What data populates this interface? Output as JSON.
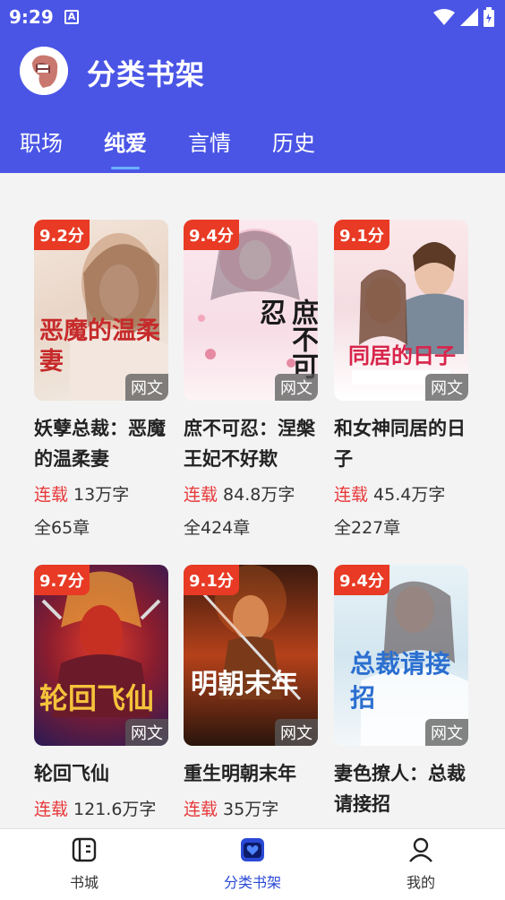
{
  "status_bar": {
    "time": "9:29",
    "notification_letter": "A"
  },
  "header": {
    "title": "分类书架"
  },
  "tabs": [
    {
      "label": "职场"
    },
    {
      "label": "纯爱"
    },
    {
      "label": "言情"
    },
    {
      "label": "历史"
    }
  ],
  "active_tab": "纯爱",
  "books": [
    {
      "score": "9.2分",
      "source": "网文",
      "title": "妖孽总裁：恶魔的温柔妻",
      "status": "连载",
      "words": "13万字",
      "chapters": "全65章",
      "cover_text": "恶魔的温柔妻"
    },
    {
      "score": "9.4分",
      "source": "网文",
      "title": "庶不可忍：涅槃王妃不好欺",
      "status": "连载",
      "words": "84.8万字",
      "chapters": "全424章",
      "cover_text": "庶不可忍"
    },
    {
      "score": "9.1分",
      "source": "网文",
      "title": "和女神同居的日子",
      "status": "连载",
      "words": "45.4万字",
      "chapters": "全227章",
      "cover_text": "同居的日子"
    },
    {
      "score": "9.7分",
      "source": "网文",
      "title": "轮回飞仙",
      "status": "连载",
      "words": "121.6万字",
      "chapters": "",
      "cover_text": "轮回飞仙"
    },
    {
      "score": "9.1分",
      "source": "网文",
      "title": "重生明朝末年",
      "status": "连载",
      "words": "35万字",
      "chapters": "",
      "cover_text": "明朝末年"
    },
    {
      "score": "9.4分",
      "source": "网文",
      "title": "妻色撩人：总裁请接招",
      "status": "",
      "words": "",
      "chapters": "",
      "cover_text": "总裁请接招"
    }
  ],
  "bottom_nav": [
    {
      "label": "书城",
      "icon": "book-city-icon"
    },
    {
      "label": "分类书架",
      "icon": "bookshelf-icon"
    },
    {
      "label": "我的",
      "icon": "profile-icon"
    }
  ],
  "colors": {
    "header": "#4a55e6",
    "score_badge": "#e83a24",
    "status_red": "#e8383a",
    "nav_active": "#2a49d6"
  }
}
